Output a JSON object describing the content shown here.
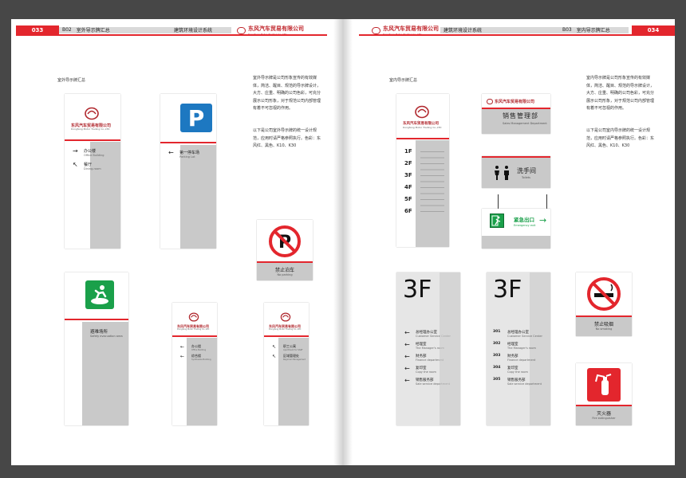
{
  "left_page": {
    "page_number": "033",
    "section_code": "B02",
    "section_title": "室外导示牌汇总",
    "system_title": "建筑环境设计系统",
    "caption": "室外导示牌汇总",
    "paragraph_1": "室外导示牌是公司形象宣传的有效媒体，简洁、醒目、规范的导示牌设计，大方、庄重、明确的公司色彩，可充分展示公司形象，对于规范公司内部管理有着不可忽视的作用。",
    "paragraph_2": "以下是公司室外导示牌的统一设计规范，应用时请严格参照执行。色彩：东风红、黑色、K10、K30",
    "signs": {
      "building": {
        "company": "东风汽车贸易有限公司",
        "company_en": "Dongfeng Motor Trading Co.,LTD",
        "row1_arrow": "→",
        "row1_cn": "办公楼",
        "row1_en": "Office Building",
        "row2_arrow": "↖",
        "row2_cn": "餐厅",
        "row2_en": "Dining-room"
      },
      "parking": {
        "icon_letter": "P",
        "arrow": "←",
        "cn": "第一停车场",
        "en": "Parking Lot"
      },
      "no_parking": {
        "cn": "禁止泊车",
        "en": "No parking"
      },
      "evacuation": {
        "cn": "避难场所",
        "en": "Safety evacuation area"
      },
      "small_a": {
        "company": "东风汽车贸易有限公司",
        "company_en": "Dongfeng Motor Trading Co.,LTD",
        "r1_cn": "办公楼",
        "r1_en": "Office Building",
        "r2_cn": "综合楼",
        "r2_en": "Synthesize Building"
      },
      "small_b": {
        "company": "东风汽车贸易有限公司",
        "company_en": "Dongfeng Motor Trading Co.,LTD",
        "r1_cn": "职工公寓",
        "r1_en": "Apartment for Staff",
        "r2_cn": "区域管理处",
        "r2_en": "Regional Management"
      }
    }
  },
  "right_page": {
    "page_number": "034",
    "section_code": "B03",
    "section_title": "室内导示牌汇总",
    "system_title": "建筑环境设计系统",
    "caption": "室内导示牌汇总",
    "paragraph_1": "室内导示牌是公司形象宣传的有效媒体，简洁、醒目、规范的导示牌设计，大方、庄重、明确的公司色彩，可充分展示公司形象，对于规范公司内部管理有着不可忽视的作用。",
    "paragraph_2": "以下是公司室内导示牌的统一设计规范，应用时请严格参照执行。色彩：东风红、黑色、K10、K30",
    "signs": {
      "directory": {
        "company": "东风汽车贸易有限公司",
        "company_en": "Dongfeng Motor Trading Co.,LTD",
        "floors": [
          "1F",
          "2F",
          "3F",
          "4F",
          "5F",
          "6F"
        ]
      },
      "sales_dept": {
        "company": "东风汽车贸易有限公司",
        "cn": "销售管理部",
        "en": "Sales Management Department"
      },
      "toilets": {
        "cn": "洗手间",
        "en": "Toilets"
      },
      "exit": {
        "cn": "紧急出口",
        "en": "Emergency exit",
        "arrow": "→"
      },
      "floor3_a": {
        "floor": "3F",
        "rows": [
          {
            "cn": "总经理办公室",
            "en": "Customer Service Center"
          },
          {
            "cn": "经理室",
            "en": "The Manager's room"
          },
          {
            "cn": "财务部",
            "en": "Finance department"
          },
          {
            "cn": "复印室",
            "en": "Copy the room"
          },
          {
            "cn": "销售服务部",
            "en": "Sale service department"
          }
        ]
      },
      "floor3_b": {
        "floor": "3F",
        "rooms": [
          "301",
          "302",
          "303",
          "304",
          "305"
        ],
        "rows": [
          {
            "cn": "总经理办公室",
            "en": "Customer Service Center"
          },
          {
            "cn": "经理室",
            "en": "The Manager's room"
          },
          {
            "cn": "财务部",
            "en": "Finance department"
          },
          {
            "cn": "复印室",
            "en": "Copy the room"
          },
          {
            "cn": "销售服务部",
            "en": "Sale service department"
          }
        ]
      },
      "no_smoking": {
        "cn": "禁止吸烟",
        "en": "No smoking"
      },
      "extinguisher": {
        "cn": "灭火器",
        "en": "Fire extinguisher"
      }
    }
  },
  "brand": {
    "company": "东风汽车贸易有限公司",
    "company_en": "Dongfeng Motor Trading Co.,LTD"
  },
  "colors": {
    "brand_red": "#e3262d",
    "parking_blue": "#1d78c1",
    "safety_green": "#1aa04a",
    "panel_grey": "#c9c9c9"
  }
}
